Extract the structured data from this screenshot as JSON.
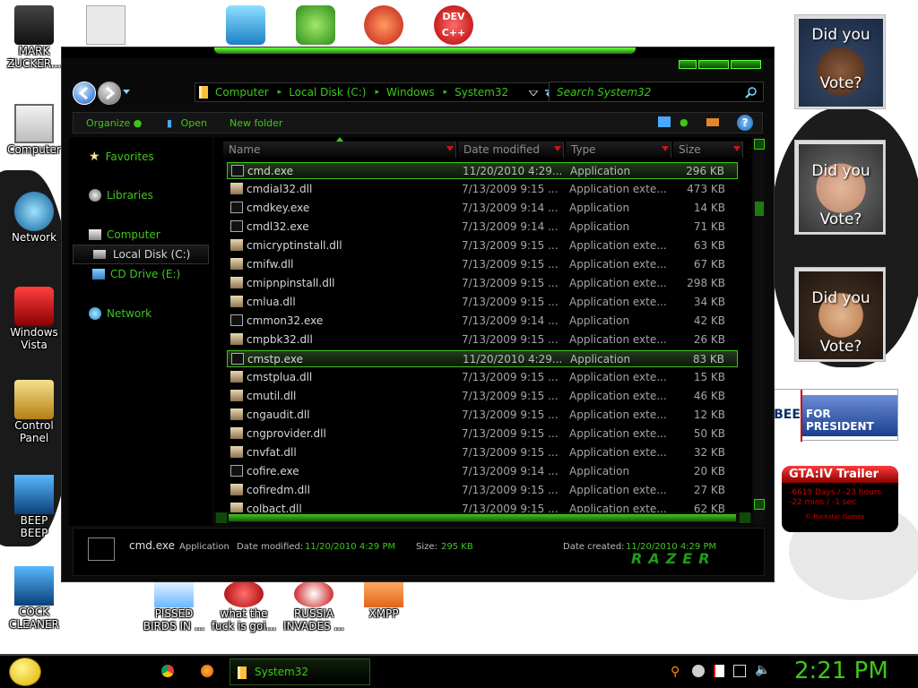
{
  "desktop_icons": [
    {
      "label": "MARK ZUCKERBERG",
      "display": "MARK\nZUCKER..."
    },
    {
      "label": "Computer"
    },
    {
      "label": "Network"
    },
    {
      "label": "Windows Vista"
    },
    {
      "label": "Control Panel"
    },
    {
      "label": "BEEP BEEP"
    },
    {
      "label": "COCK CLEANER"
    },
    {
      "label": "PISSED BIRDS IN ..."
    },
    {
      "label": "what the fuck is goi..."
    },
    {
      "label": "RUSSIA INVADES ..."
    },
    {
      "label": "XMPP"
    }
  ],
  "top_icons": [
    {
      "name": "paper-icon"
    },
    {
      "name": "launcher-icon"
    },
    {
      "name": "game-icon"
    },
    {
      "name": "p-icon"
    },
    {
      "label": "DEV C++"
    }
  ],
  "gadgets": {
    "vote": [
      {
        "top": "Did you",
        "bottom": "Vote?"
      },
      {
        "top": "Did you",
        "bottom": "Vote?"
      },
      {
        "top": "Did you",
        "bottom": "Vote?"
      }
    ],
    "banner": {
      "left": "BEE",
      "right": "FOR PRESIDENT"
    },
    "gta": {
      "title": "GTA:IV Trailer",
      "line1": "-6619 Days / -23 hours",
      "line2": "-22 mins / -1 sec",
      "footer": "© Rockstar Games"
    }
  },
  "window": {
    "breadcrumb": [
      "Computer",
      "Local Disk (C:)",
      "Windows",
      "System32"
    ],
    "search_placeholder": "Search System32",
    "toolbar": {
      "organize": "Organize",
      "open": "Open",
      "new_folder": "New folder"
    },
    "nav": {
      "favorites": "Favorites",
      "libraries": "Libraries",
      "computer": "Computer",
      "local_disk": "Local Disk (C:)",
      "cd_drive": "CD Drive (E:)",
      "network": "Network"
    },
    "columns": {
      "name": "Name",
      "date": "Date modified",
      "type": "Type",
      "size": "Size"
    },
    "files": [
      {
        "name": "cmd.exe",
        "date": "11/20/2010 4:29...",
        "type": "Application",
        "size": "296 KB",
        "selected": true
      },
      {
        "name": "cmdial32.dll",
        "date": "7/13/2009 9:15 ...",
        "type": "Application exte...",
        "size": "473 KB"
      },
      {
        "name": "cmdkey.exe",
        "date": "7/13/2009 9:14 ...",
        "type": "Application",
        "size": "14 KB"
      },
      {
        "name": "cmdl32.exe",
        "date": "7/13/2009 9:14 ...",
        "type": "Application",
        "size": "71 KB"
      },
      {
        "name": "cmicryptinstall.dll",
        "date": "7/13/2009 9:15 ...",
        "type": "Application exte...",
        "size": "63 KB"
      },
      {
        "name": "cmifw.dll",
        "date": "7/13/2009 9:15 ...",
        "type": "Application exte...",
        "size": "67 KB"
      },
      {
        "name": "cmipnpinstall.dll",
        "date": "7/13/2009 9:15 ...",
        "type": "Application exte...",
        "size": "298 KB"
      },
      {
        "name": "cmlua.dll",
        "date": "7/13/2009 9:15 ...",
        "type": "Application exte...",
        "size": "34 KB"
      },
      {
        "name": "cmmon32.exe",
        "date": "7/13/2009 9:14 ...",
        "type": "Application",
        "size": "42 KB"
      },
      {
        "name": "cmpbk32.dll",
        "date": "7/13/2009 9:15 ...",
        "type": "Application exte...",
        "size": "26 KB"
      },
      {
        "name": "cmstp.exe",
        "date": "11/20/2010 4:29...",
        "type": "Application",
        "size": "83 KB",
        "hover": true
      },
      {
        "name": "cmstplua.dll",
        "date": "7/13/2009 9:15 ...",
        "type": "Application exte...",
        "size": "15 KB"
      },
      {
        "name": "cmutil.dll",
        "date": "7/13/2009 9:15 ...",
        "type": "Application exte...",
        "size": "46 KB"
      },
      {
        "name": "cngaudit.dll",
        "date": "7/13/2009 9:15 ...",
        "type": "Application exte...",
        "size": "12 KB"
      },
      {
        "name": "cngprovider.dll",
        "date": "7/13/2009 9:15 ...",
        "type": "Application exte...",
        "size": "50 KB"
      },
      {
        "name": "cnvfat.dll",
        "date": "7/13/2009 9:15 ...",
        "type": "Application exte...",
        "size": "32 KB"
      },
      {
        "name": "cofire.exe",
        "date": "7/13/2009 9:14 ...",
        "type": "Application",
        "size": "20 KB"
      },
      {
        "name": "cofiredm.dll",
        "date": "7/13/2009 9:15 ...",
        "type": "Application exte...",
        "size": "27 KB"
      },
      {
        "name": "colbact.dll",
        "date": "7/13/2009 9:15 ...",
        "type": "Application exte...",
        "size": "62 KB"
      }
    ],
    "details": {
      "filename": "cmd.exe",
      "type": "Application",
      "modified_label": "Date modified:",
      "modified": "11/20/2010 4:29 PM",
      "size_label": "Size:",
      "size": "295 KB",
      "created_label": "Date created:",
      "created": "11/20/2010 4:29 PM",
      "brand": "RAZER"
    }
  },
  "taskbar": {
    "task": "System32",
    "clock": "2:21 PM"
  },
  "colors": {
    "accent": "#3ec71a",
    "window_bg": "#0a0a0a"
  }
}
